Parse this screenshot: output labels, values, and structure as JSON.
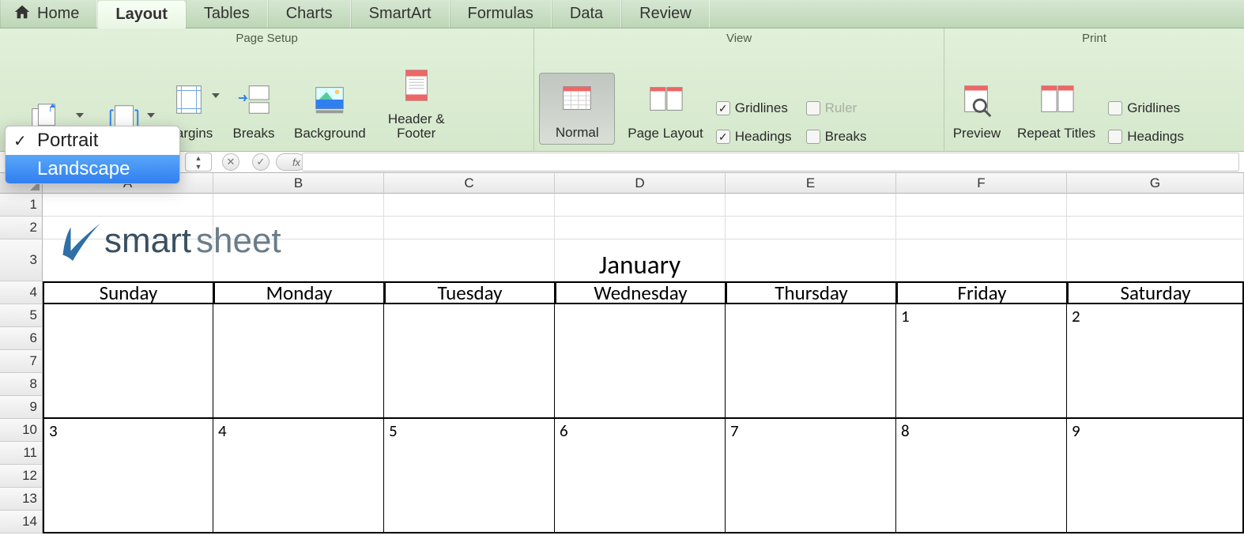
{
  "tabs": {
    "home": "Home",
    "layout": "Layout",
    "tables": "Tables",
    "charts": "Charts",
    "smartart": "SmartArt",
    "formulas": "Formulas",
    "data": "Data",
    "review": "Review"
  },
  "groups": {
    "page_setup": {
      "title": "Page Setup",
      "margins": "Margins",
      "breaks": "Breaks",
      "background": "Background",
      "header_footer": "Header &\nFooter"
    },
    "view": {
      "title": "View",
      "normal": "Normal",
      "page_layout": "Page Layout",
      "gridlines": "Gridlines",
      "ruler": "Ruler",
      "headings": "Headings",
      "breaks": "Breaks"
    },
    "print": {
      "title": "Print",
      "preview": "Preview",
      "repeat_titles": "Repeat Titles",
      "gridlines": "Gridlines",
      "headings": "Headings"
    }
  },
  "orientation_menu": {
    "portrait": "Portrait",
    "landscape": "Landscape",
    "checked": "portrait",
    "highlighted": "landscape"
  },
  "formula_bar": {
    "fx": "fx",
    "value": ""
  },
  "colheaders": [
    "A",
    "B",
    "C",
    "D",
    "E",
    "F",
    "G"
  ],
  "rowheaders": [
    "1",
    "2",
    "3",
    "4",
    "5",
    "6",
    "7",
    "8",
    "9",
    "10",
    "11",
    "12",
    "13",
    "14"
  ],
  "logo": {
    "word1": "smart",
    "word2": "sheet"
  },
  "calendar": {
    "month": "January",
    "days": [
      "Sunday",
      "Monday",
      "Tuesday",
      "Wednesday",
      "Thursday",
      "Friday",
      "Saturday"
    ],
    "week1": [
      "",
      "",
      "",
      "",
      "",
      "1",
      "2"
    ],
    "week2": [
      "3",
      "4",
      "5",
      "6",
      "7",
      "8",
      "9"
    ]
  },
  "checkbox_state": {
    "view_gridlines": true,
    "view_ruler": false,
    "view_headings": true,
    "view_breaks": false,
    "print_gridlines": false,
    "print_headings": false
  }
}
